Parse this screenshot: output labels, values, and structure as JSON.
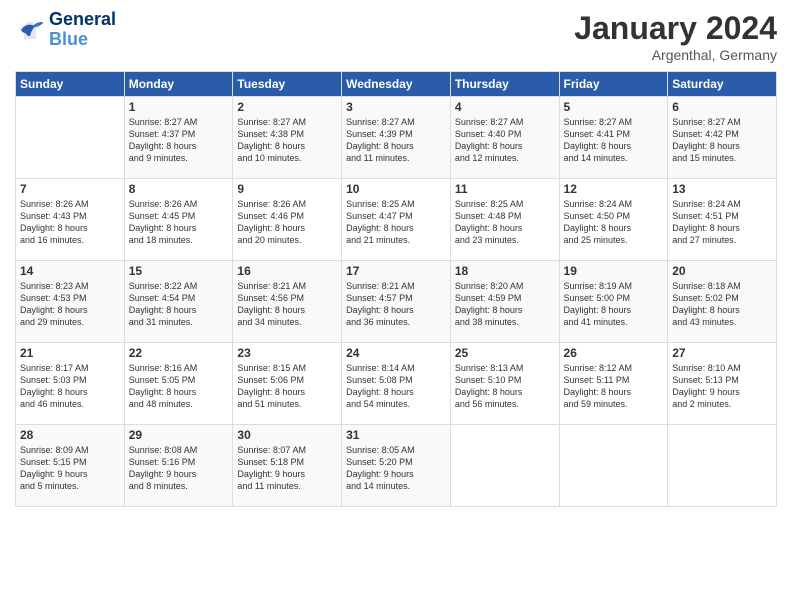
{
  "header": {
    "logo_line1": "General",
    "logo_line2": "Blue",
    "month": "January 2024",
    "location": "Argenthal, Germany"
  },
  "weekdays": [
    "Sunday",
    "Monday",
    "Tuesday",
    "Wednesday",
    "Thursday",
    "Friday",
    "Saturday"
  ],
  "weeks": [
    [
      {
        "day": "",
        "info": ""
      },
      {
        "day": "1",
        "info": "Sunrise: 8:27 AM\nSunset: 4:37 PM\nDaylight: 8 hours\nand 9 minutes."
      },
      {
        "day": "2",
        "info": "Sunrise: 8:27 AM\nSunset: 4:38 PM\nDaylight: 8 hours\nand 10 minutes."
      },
      {
        "day": "3",
        "info": "Sunrise: 8:27 AM\nSunset: 4:39 PM\nDaylight: 8 hours\nand 11 minutes."
      },
      {
        "day": "4",
        "info": "Sunrise: 8:27 AM\nSunset: 4:40 PM\nDaylight: 8 hours\nand 12 minutes."
      },
      {
        "day": "5",
        "info": "Sunrise: 8:27 AM\nSunset: 4:41 PM\nDaylight: 8 hours\nand 14 minutes."
      },
      {
        "day": "6",
        "info": "Sunrise: 8:27 AM\nSunset: 4:42 PM\nDaylight: 8 hours\nand 15 minutes."
      }
    ],
    [
      {
        "day": "7",
        "info": "Sunrise: 8:26 AM\nSunset: 4:43 PM\nDaylight: 8 hours\nand 16 minutes."
      },
      {
        "day": "8",
        "info": "Sunrise: 8:26 AM\nSunset: 4:45 PM\nDaylight: 8 hours\nand 18 minutes."
      },
      {
        "day": "9",
        "info": "Sunrise: 8:26 AM\nSunset: 4:46 PM\nDaylight: 8 hours\nand 20 minutes."
      },
      {
        "day": "10",
        "info": "Sunrise: 8:25 AM\nSunset: 4:47 PM\nDaylight: 8 hours\nand 21 minutes."
      },
      {
        "day": "11",
        "info": "Sunrise: 8:25 AM\nSunset: 4:48 PM\nDaylight: 8 hours\nand 23 minutes."
      },
      {
        "day": "12",
        "info": "Sunrise: 8:24 AM\nSunset: 4:50 PM\nDaylight: 8 hours\nand 25 minutes."
      },
      {
        "day": "13",
        "info": "Sunrise: 8:24 AM\nSunset: 4:51 PM\nDaylight: 8 hours\nand 27 minutes."
      }
    ],
    [
      {
        "day": "14",
        "info": "Sunrise: 8:23 AM\nSunset: 4:53 PM\nDaylight: 8 hours\nand 29 minutes."
      },
      {
        "day": "15",
        "info": "Sunrise: 8:22 AM\nSunset: 4:54 PM\nDaylight: 8 hours\nand 31 minutes."
      },
      {
        "day": "16",
        "info": "Sunrise: 8:21 AM\nSunset: 4:56 PM\nDaylight: 8 hours\nand 34 minutes."
      },
      {
        "day": "17",
        "info": "Sunrise: 8:21 AM\nSunset: 4:57 PM\nDaylight: 8 hours\nand 36 minutes."
      },
      {
        "day": "18",
        "info": "Sunrise: 8:20 AM\nSunset: 4:59 PM\nDaylight: 8 hours\nand 38 minutes."
      },
      {
        "day": "19",
        "info": "Sunrise: 8:19 AM\nSunset: 5:00 PM\nDaylight: 8 hours\nand 41 minutes."
      },
      {
        "day": "20",
        "info": "Sunrise: 8:18 AM\nSunset: 5:02 PM\nDaylight: 8 hours\nand 43 minutes."
      }
    ],
    [
      {
        "day": "21",
        "info": "Sunrise: 8:17 AM\nSunset: 5:03 PM\nDaylight: 8 hours\nand 46 minutes."
      },
      {
        "day": "22",
        "info": "Sunrise: 8:16 AM\nSunset: 5:05 PM\nDaylight: 8 hours\nand 48 minutes."
      },
      {
        "day": "23",
        "info": "Sunrise: 8:15 AM\nSunset: 5:06 PM\nDaylight: 8 hours\nand 51 minutes."
      },
      {
        "day": "24",
        "info": "Sunrise: 8:14 AM\nSunset: 5:08 PM\nDaylight: 8 hours\nand 54 minutes."
      },
      {
        "day": "25",
        "info": "Sunrise: 8:13 AM\nSunset: 5:10 PM\nDaylight: 8 hours\nand 56 minutes."
      },
      {
        "day": "26",
        "info": "Sunrise: 8:12 AM\nSunset: 5:11 PM\nDaylight: 8 hours\nand 59 minutes."
      },
      {
        "day": "27",
        "info": "Sunrise: 8:10 AM\nSunset: 5:13 PM\nDaylight: 9 hours\nand 2 minutes."
      }
    ],
    [
      {
        "day": "28",
        "info": "Sunrise: 8:09 AM\nSunset: 5:15 PM\nDaylight: 9 hours\nand 5 minutes."
      },
      {
        "day": "29",
        "info": "Sunrise: 8:08 AM\nSunset: 5:16 PM\nDaylight: 9 hours\nand 8 minutes."
      },
      {
        "day": "30",
        "info": "Sunrise: 8:07 AM\nSunset: 5:18 PM\nDaylight: 9 hours\nand 11 minutes."
      },
      {
        "day": "31",
        "info": "Sunrise: 8:05 AM\nSunset: 5:20 PM\nDaylight: 9 hours\nand 14 minutes."
      },
      {
        "day": "",
        "info": ""
      },
      {
        "day": "",
        "info": ""
      },
      {
        "day": "",
        "info": ""
      }
    ]
  ]
}
